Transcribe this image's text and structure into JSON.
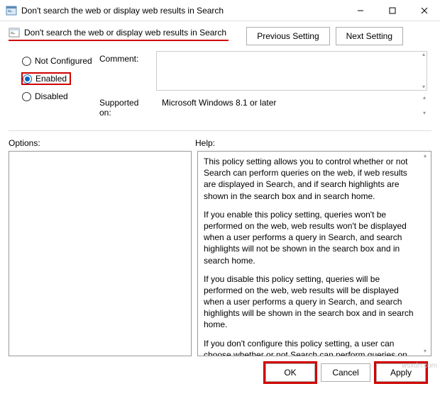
{
  "titlebar": {
    "title": "Don't search the web or display web results in Search"
  },
  "header": {
    "title": "Don't search the web or display web results in Search",
    "previous": "Previous Setting",
    "next": "Next Setting"
  },
  "state": {
    "not_configured": "Not Configured",
    "enabled": "Enabled",
    "disabled": "Disabled",
    "selected": "enabled"
  },
  "fields": {
    "comment_label": "Comment:",
    "supported_label": "Supported on:",
    "supported_value": "Microsoft Windows 8.1 or later"
  },
  "labels": {
    "options": "Options:",
    "help": "Help:"
  },
  "help_text": {
    "p1": "This policy setting allows you to control whether or not Search can perform queries on the web, if web results are displayed in Search, and if search highlights are shown in the search box and in search home.",
    "p2": "If you enable this policy setting, queries won't be performed on the web, web results won't be displayed when a user performs a query in Search, and search highlights will not be shown in the search box and in search home.",
    "p3": "If you disable this policy setting, queries will be performed on the web, web results will be displayed when a user performs a query in Search, and search highlights will be shown in the search box and in search home.",
    "p4": "If you don't configure this policy setting, a user can choose whether or not Search can perform queries on the web, and if the web results are displayed in Search, and if search highlights are shown in the search box and in search home."
  },
  "footer": {
    "ok": "OK",
    "cancel": "Cancel",
    "apply": "Apply"
  },
  "watermark": "wsxdn.com"
}
